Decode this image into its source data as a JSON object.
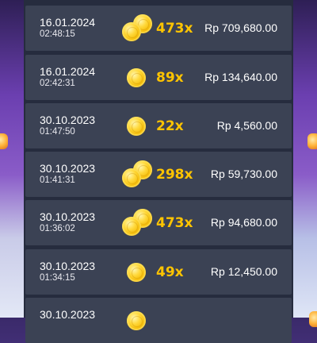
{
  "history": {
    "rows": [
      {
        "date": "16.01.2024",
        "time": "02:48:15",
        "multiplier": "473x",
        "amount": "Rp 709,680.00",
        "coin_icon": "coin-stack-icon"
      },
      {
        "date": "16.01.2024",
        "time": "02:42:31",
        "multiplier": "89x",
        "amount": "Rp 134,640.00",
        "coin_icon": "coin-icon"
      },
      {
        "date": "30.10.2023",
        "time": "01:47:50",
        "multiplier": "22x",
        "amount": "Rp 4,560.00",
        "coin_icon": "coin-icon"
      },
      {
        "date": "30.10.2023",
        "time": "01:41:31",
        "multiplier": "298x",
        "amount": "Rp 59,730.00",
        "coin_icon": "coin-stack-icon"
      },
      {
        "date": "30.10.2023",
        "time": "01:36:02",
        "multiplier": "473x",
        "amount": "Rp 94,680.00",
        "coin_icon": "coin-stack-icon"
      },
      {
        "date": "30.10.2023",
        "time": "01:34:15",
        "multiplier": "49x",
        "amount": "Rp 12,450.00",
        "coin_icon": "coin-icon"
      },
      {
        "date": "30.10.2023",
        "time": "",
        "multiplier": "",
        "amount": "",
        "coin_icon": "coin-icon"
      }
    ]
  },
  "colors": {
    "panel": "#262c3e",
    "row": "#3b4254",
    "multiplier": "#ffc400",
    "text": "#ffffff"
  }
}
